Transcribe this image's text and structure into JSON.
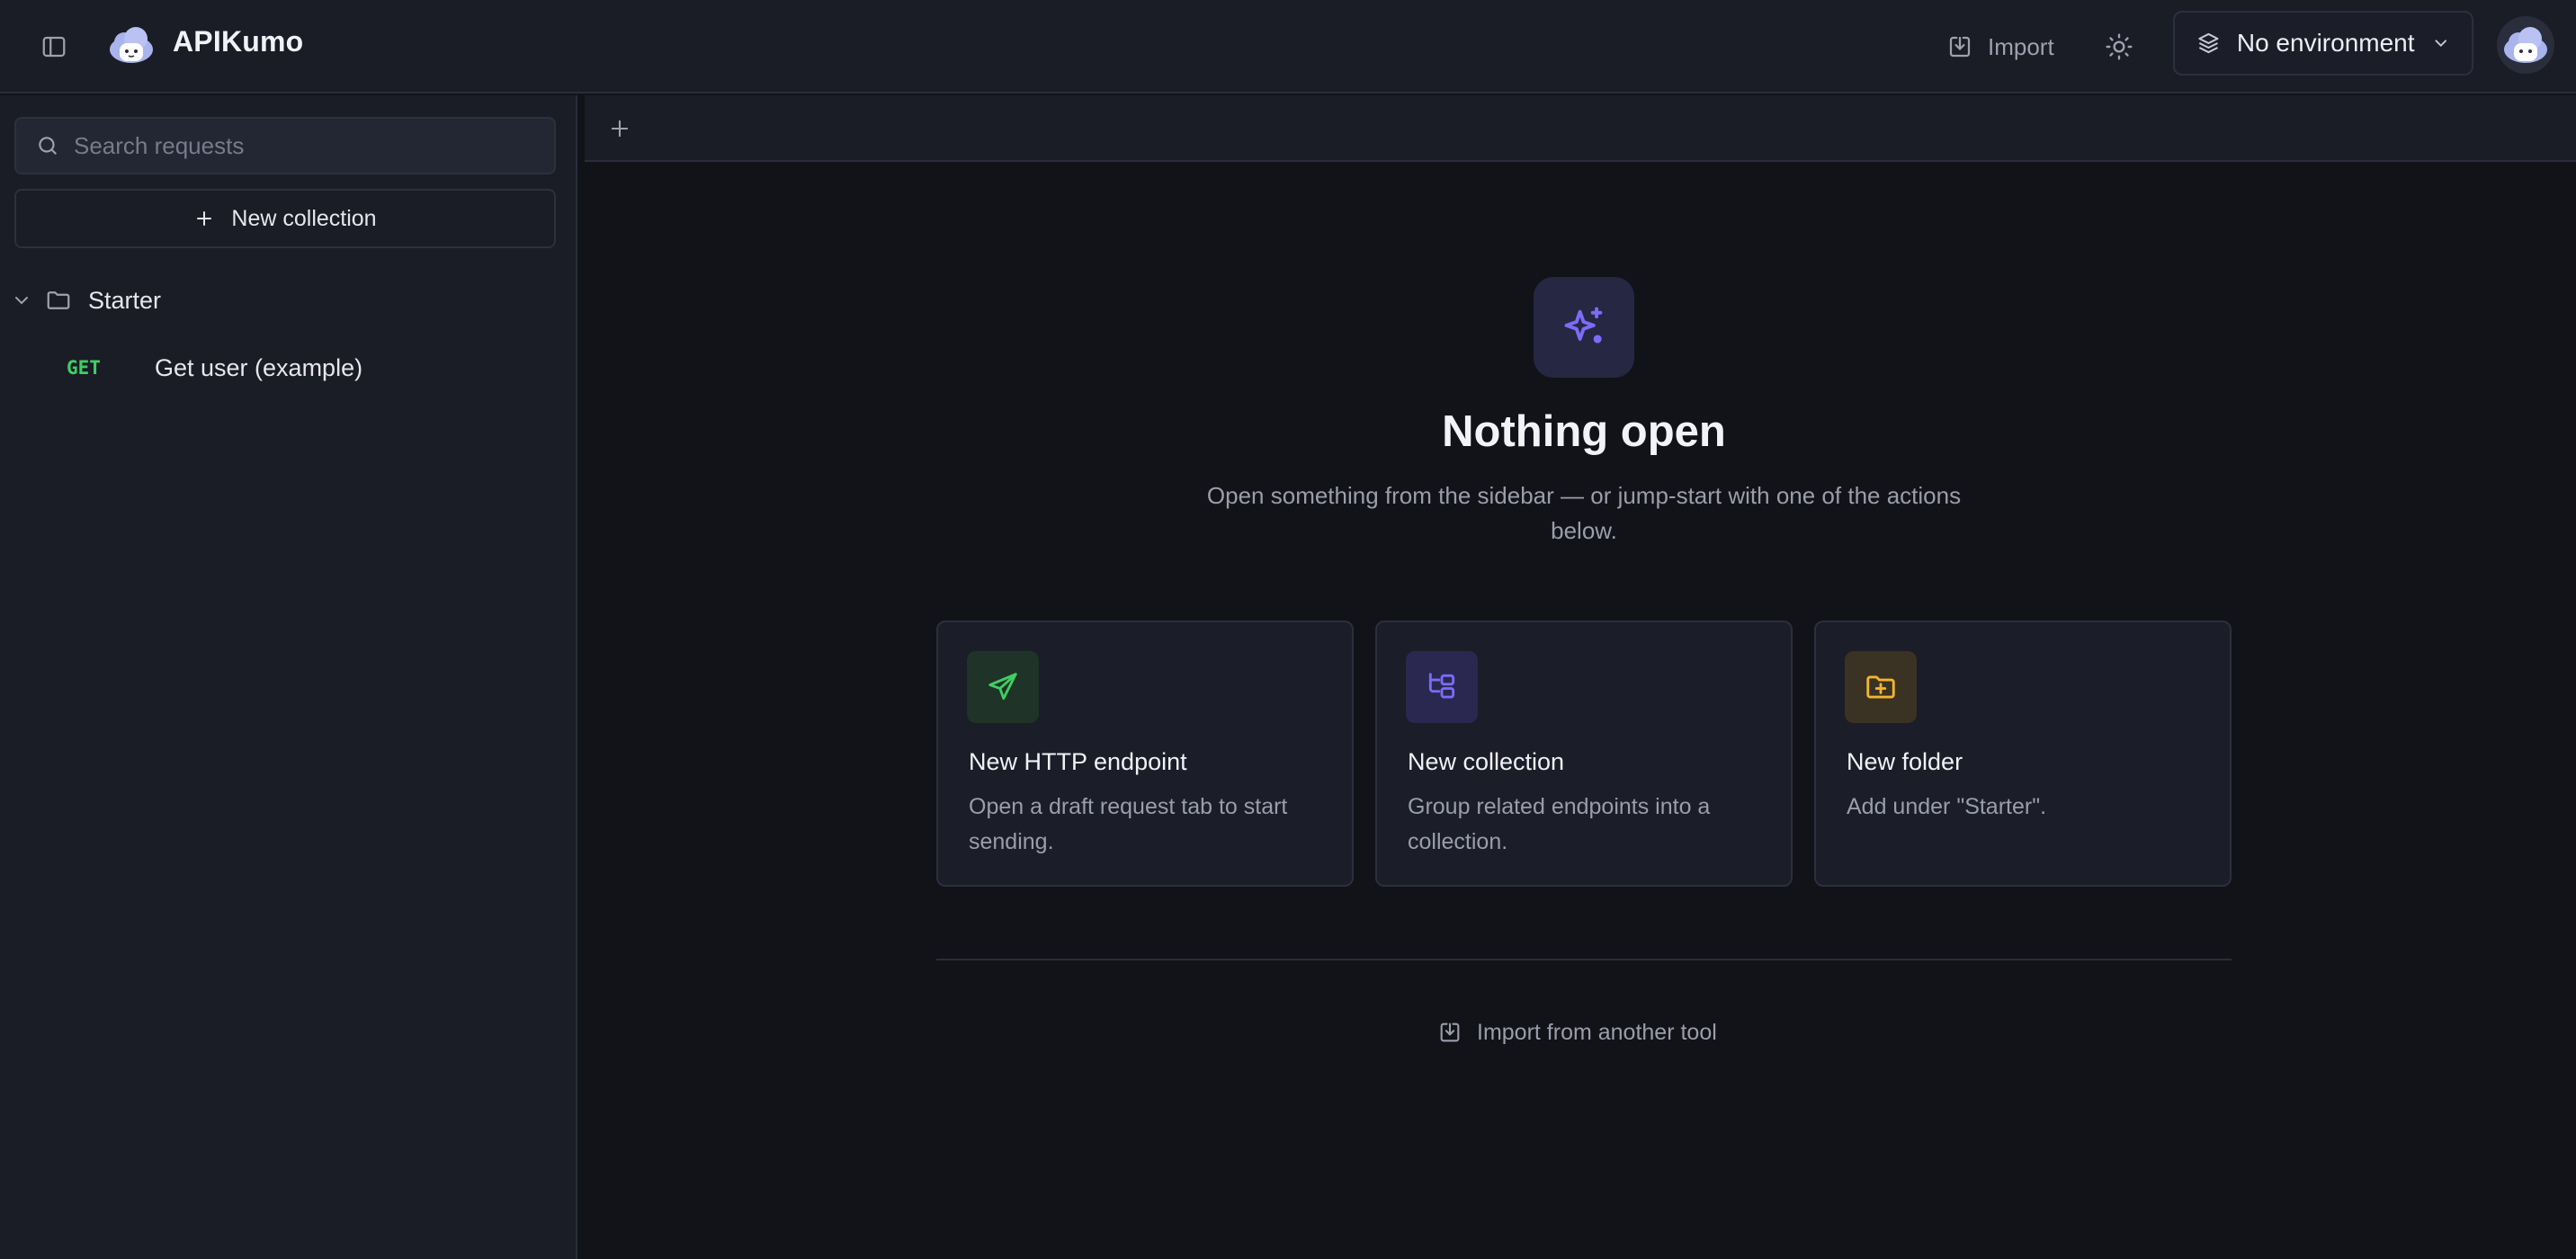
{
  "app": {
    "title": "APIKumo",
    "logo_icon": "cloud-cat-logo"
  },
  "header": {
    "import_label": "Import",
    "environment": {
      "selected": "No environment"
    }
  },
  "sidebar": {
    "search": {
      "placeholder": "Search requests",
      "value": ""
    },
    "new_collection_label": "New collection",
    "tree": [
      {
        "type": "folder",
        "label": "Starter",
        "expanded": true,
        "children": [
          {
            "method": "GET",
            "label": "Get user (example)"
          }
        ]
      }
    ]
  },
  "empty_state": {
    "title": "Nothing open",
    "subtitle": "Open something from the sidebar — or jump-start with one of the actions below.",
    "cards": [
      {
        "title": "New HTTP endpoint",
        "description": "Open a draft request tab to start sending.",
        "icon": "send-icon",
        "accent": "#3ecf63"
      },
      {
        "title": "New collection",
        "description": "Group related endpoints into a collection.",
        "icon": "collection-tree-icon",
        "accent": "#7b6cf6"
      },
      {
        "title": "New folder",
        "description": "Add under \"Starter\".",
        "icon": "folder-plus-icon",
        "accent": "#f2b530"
      }
    ],
    "import_link": "Import from another tool"
  },
  "colors": {
    "background": "#121318",
    "panel": "#1a1c26",
    "border": "#2a2d3a",
    "get_method": "#3ecf63",
    "accent_purple": "#7b6cf6",
    "accent_amber": "#f2b530"
  }
}
